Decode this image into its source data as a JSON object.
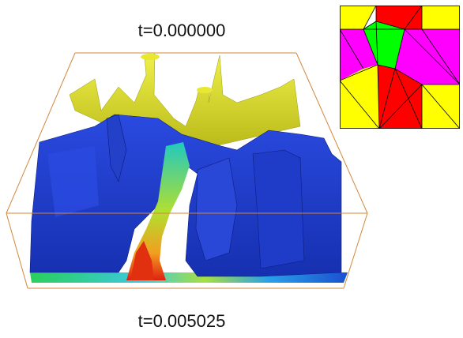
{
  "labels": {
    "top_time": "t=0.000000",
    "bottom_time": "t=0.005025"
  },
  "colors": {
    "box_edges": "#d2873a",
    "isosurface_yellow": "#d8d82a",
    "isosurface_blue": "#1f3fcf",
    "mesh_yellow": "#ffff00",
    "mesh_red": "#ff0000",
    "mesh_magenta": "#ff00ff",
    "mesh_green": "#00ff00"
  }
}
